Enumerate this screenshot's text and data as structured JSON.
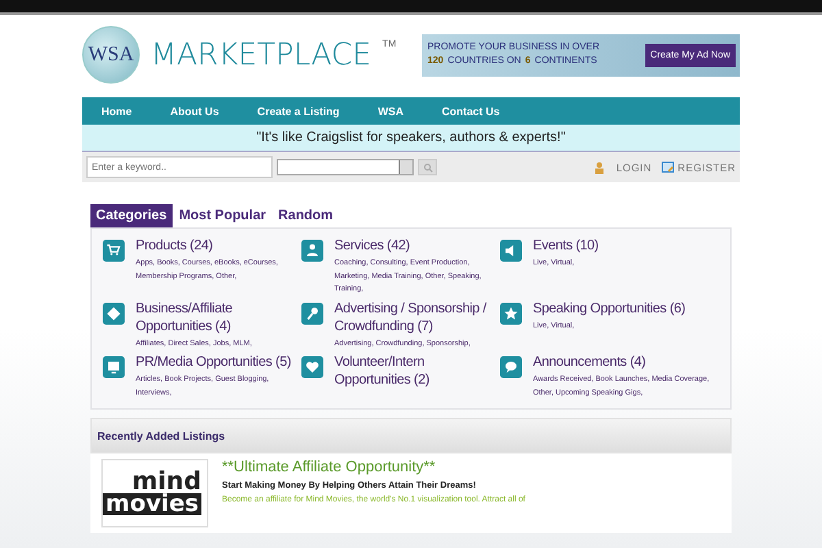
{
  "header": {
    "logo_globe": "WSA",
    "logo_word": "MARKETPLACE",
    "logo_tm": "TM",
    "banner": {
      "line_1": "PROMOTE YOUR BUSINESS IN OVER",
      "line_2_a": "120",
      "line_2_b": "COUNTRIES ON",
      "line_2_c": "6",
      "line_2_d": "CONTINENTS",
      "button": "Create My Ad Now"
    }
  },
  "nav": [
    "Home",
    "About Us",
    "Create a Listing",
    "WSA",
    "Contact Us"
  ],
  "tagline": "\"It's like Craigslist for speakers, authors & experts!\"",
  "search": {
    "placeholder": "Enter a keyword..",
    "login": "LOGIN",
    "register": "REGISTER"
  },
  "tabs": [
    {
      "label": "Categories",
      "selected": true
    },
    {
      "label": "Most Popular",
      "selected": false
    },
    {
      "label": "Random",
      "selected": false
    }
  ],
  "categories": [
    {
      "kind": "cart",
      "title": "Products (24)",
      "subs": "Apps, Books, Courses, eBooks, eCourses, Membership Programs, Other,"
    },
    {
      "kind": "person",
      "title": "Services (42)",
      "subs": "Coaching, Consulting, Event Production, Marketing, Media Training, Other, Speaking, Training,"
    },
    {
      "kind": "speaker",
      "title": "Events (10)",
      "subs": "Live, Virtual,"
    },
    {
      "kind": "diamond",
      "title": "Business/Affiliate Opportunities (4)",
      "subs": "Affiliates, Direct Sales, Jobs, MLM,"
    },
    {
      "kind": "pin",
      "title": "Advertising / Sponsorship / Crowdfunding (7)",
      "subs": "Advertising, Crowdfunding, Sponsorship,"
    },
    {
      "kind": "star",
      "title": "Speaking Opportunities (6)",
      "subs": "Live, Virtual,"
    },
    {
      "kind": "screen",
      "title": "PR/Media Opportunities (5)",
      "subs": "Articles, Book Projects, Guest Blogging, Interviews,"
    },
    {
      "kind": "heart",
      "title": "Volunteer/Intern Opportunities (2)"
    },
    {
      "kind": "bubble",
      "title": "Announcements (4)",
      "subs": "Awards Received, Book Launches, Media Coverage, Other, Upcoming Speaking Gigs,"
    }
  ],
  "recent": {
    "title": "Recently Added Listings",
    "listings": [
      {
        "thumb_1": "mind",
        "thumb_2": "movies",
        "title": "**Ultimate Affiliate Opportunity**",
        "subtitle": "Start Making Money By Helping Others Attain Their Dreams!",
        "text": "Become an affiliate for Mind Movies, the world's No.1 visualization tool. Attract all of"
      }
    ]
  }
}
